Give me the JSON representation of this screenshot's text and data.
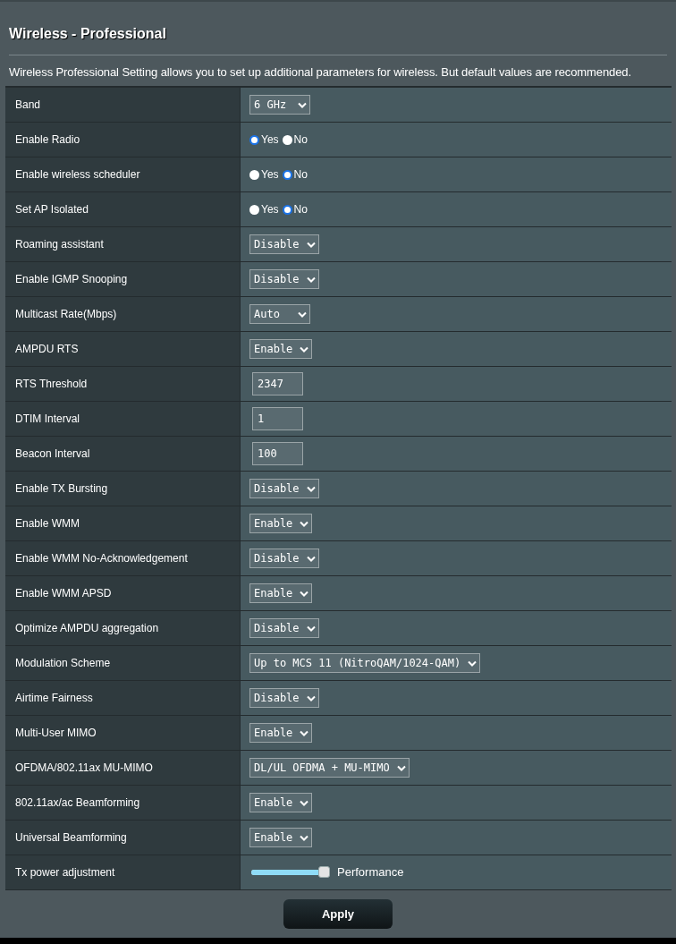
{
  "title": "Wireless - Professional",
  "description": "Wireless Professional Setting allows you to set up additional parameters for wireless. But default values are recommended.",
  "settings": [
    {
      "label": "Band",
      "kind": "select",
      "value": "6 GHz"
    },
    {
      "label": "Enable Radio",
      "kind": "radio",
      "options": [
        {
          "label": "Yes",
          "selected": true
        },
        {
          "label": "No",
          "selected": false
        }
      ]
    },
    {
      "label": "Enable wireless scheduler",
      "kind": "radio",
      "options": [
        {
          "label": "Yes",
          "selected": false
        },
        {
          "label": "No",
          "selected": true
        }
      ]
    },
    {
      "label": "Set AP Isolated",
      "kind": "radio",
      "options": [
        {
          "label": "Yes",
          "selected": false
        },
        {
          "label": "No",
          "selected": true
        }
      ]
    },
    {
      "label": "Roaming assistant",
      "kind": "select",
      "value": "Disable"
    },
    {
      "label": "Enable IGMP Snooping",
      "kind": "select",
      "value": "Disable"
    },
    {
      "label": "Multicast Rate(Mbps)",
      "kind": "select",
      "value": "Auto"
    },
    {
      "label": "AMPDU RTS",
      "kind": "select",
      "value": "Enable"
    },
    {
      "label": "RTS Threshold",
      "kind": "input",
      "value": "2347"
    },
    {
      "label": "DTIM Interval",
      "kind": "input",
      "value": "1"
    },
    {
      "label": "Beacon Interval",
      "kind": "input",
      "value": "100"
    },
    {
      "label": "Enable TX Bursting",
      "kind": "select",
      "value": "Disable"
    },
    {
      "label": "Enable WMM",
      "kind": "select",
      "value": "Enable"
    },
    {
      "label": "Enable WMM No-Acknowledgement",
      "kind": "select",
      "value": "Disable"
    },
    {
      "label": "Enable WMM APSD",
      "kind": "select",
      "value": "Enable"
    },
    {
      "label": "Optimize AMPDU aggregation",
      "kind": "select",
      "value": "Disable"
    },
    {
      "label": "Modulation Scheme",
      "kind": "select",
      "value": "Up to MCS 11 (NitroQAM/1024-QAM)"
    },
    {
      "label": "Airtime Fairness",
      "kind": "select",
      "value": "Disable"
    },
    {
      "label": "Multi-User MIMO",
      "kind": "select",
      "value": "Enable"
    },
    {
      "label": "OFDMA/802.11ax MU-MIMO",
      "kind": "select",
      "value": "DL/UL OFDMA + MU-MIMO"
    },
    {
      "label": "802.11ax/ac Beamforming",
      "kind": "select",
      "value": "Enable"
    },
    {
      "label": "Universal Beamforming",
      "kind": "select",
      "value": "Enable"
    },
    {
      "label": "Tx power adjustment",
      "kind": "slider",
      "level": 1,
      "reading": "Performance"
    }
  ],
  "apply_button": "Apply"
}
